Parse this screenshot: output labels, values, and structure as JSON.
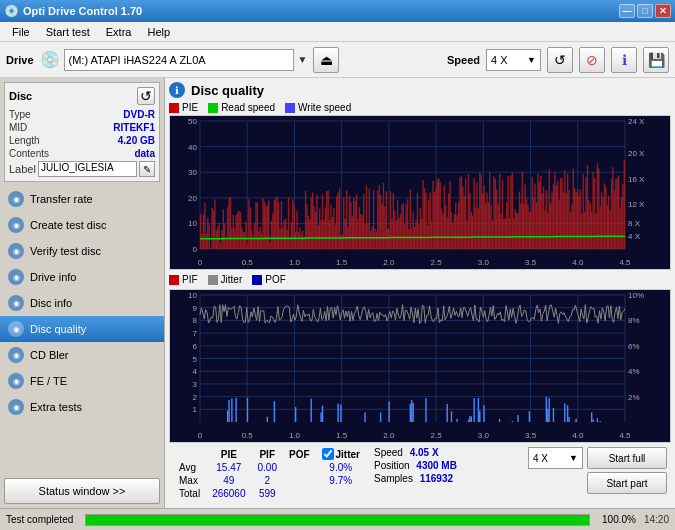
{
  "titleBar": {
    "title": "Opti Drive Control 1.70",
    "minBtn": "—",
    "maxBtn": "□",
    "closeBtn": "✕"
  },
  "menu": {
    "items": [
      "File",
      "Start test",
      "Extra",
      "Help"
    ]
  },
  "toolbar": {
    "driveLabel": "Drive",
    "driveValue": "(M:)  ATAPI iHAS224  A ZL0A",
    "speedLabel": "Speed",
    "speedValue": "4 X"
  },
  "disc": {
    "sectionTitle": "Disc",
    "fields": [
      {
        "key": "Type",
        "value": "DVD-R"
      },
      {
        "key": "MID",
        "value": "RITEKF1"
      },
      {
        "key": "Length",
        "value": "4.20 GB"
      },
      {
        "key": "Contents",
        "value": "data"
      },
      {
        "key": "Label",
        "value": "JULIO_IGLESIA"
      }
    ]
  },
  "nav": {
    "items": [
      {
        "id": "transfer-rate",
        "label": "Transfer rate",
        "active": false
      },
      {
        "id": "create-test-disc",
        "label": "Create test disc",
        "active": false
      },
      {
        "id": "verify-test-disc",
        "label": "Verify test disc",
        "active": false
      },
      {
        "id": "drive-info",
        "label": "Drive info",
        "active": false
      },
      {
        "id": "disc-info",
        "label": "Disc info",
        "active": false
      },
      {
        "id": "disc-quality",
        "label": "Disc quality",
        "active": true
      },
      {
        "id": "cd-bler",
        "label": "CD Bler",
        "active": false
      },
      {
        "id": "fe-te",
        "label": "FE / TE",
        "active": false
      },
      {
        "id": "extra-tests",
        "label": "Extra tests",
        "active": false
      }
    ]
  },
  "sidebarBtn": "Status window >>",
  "panel": {
    "title": "Disc quality",
    "legend": [
      {
        "label": "PIE",
        "color": "#cc0000"
      },
      {
        "label": "Read speed",
        "color": "#00cc00"
      },
      {
        "label": "Write speed",
        "color": "#4444ff"
      }
    ],
    "legend2": [
      {
        "label": "PIF",
        "color": "#cc0000"
      },
      {
        "label": "Jitter",
        "color": "#888888"
      },
      {
        "label": "POF",
        "color": "#0000aa"
      }
    ]
  },
  "stats": {
    "columns": [
      "PIE",
      "PIF",
      "POF",
      "Jitter"
    ],
    "rows": [
      {
        "label": "Avg",
        "pie": "15.47",
        "pif": "0.00",
        "pof": "",
        "jitter": "9.0%"
      },
      {
        "label": "Max",
        "pie": "49",
        "pif": "2",
        "pof": "",
        "jitter": "9.7%"
      },
      {
        "label": "Total",
        "pie": "266060",
        "pif": "599",
        "pof": "",
        "jitter": ""
      }
    ],
    "speed": {
      "label": "Speed",
      "value": "4.05 X",
      "posLabel": "Position",
      "posValue": "4300 MB",
      "samplesLabel": "Samples",
      "samplesValue": "116932"
    },
    "speedDropdown": "4 X",
    "startFullBtn": "Start full",
    "startPartBtn": "Start part"
  },
  "statusBar": {
    "text": "Test completed",
    "progress": 100,
    "progressText": "100.0%",
    "time": "14:20"
  }
}
